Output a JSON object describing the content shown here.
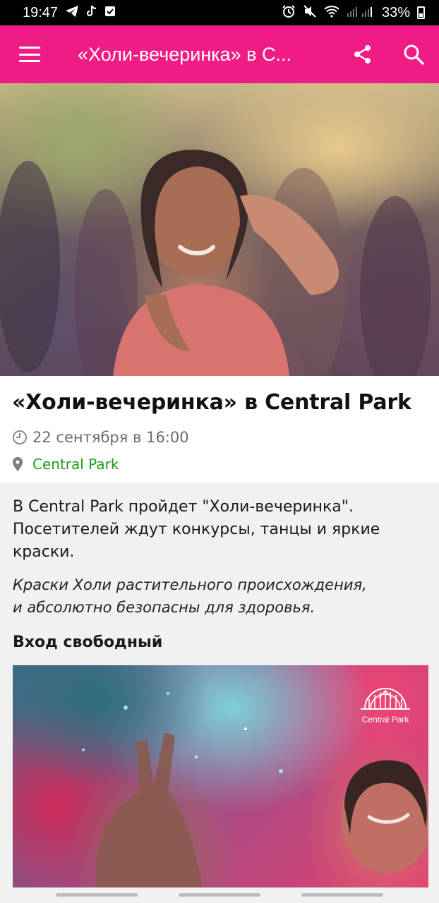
{
  "status_bar": {
    "time": "19:47",
    "battery": "33%"
  },
  "app_bar": {
    "title": "«Холи-вечеринка» в Central Park",
    "title_display": "«Холи-вечеринка» в C...",
    "icons": [
      "menu-icon",
      "share-icon",
      "search-icon"
    ],
    "background": "#ee1c84"
  },
  "event": {
    "title": "«Холи-вечеринка» в Central Park",
    "date": "22 сентября в 16:00",
    "place": "Central Park",
    "place_color": "#1b9c1b"
  },
  "description": {
    "paragraph": "В Central Park пройдет \"Холи-вечеринка\". Посетителей ждут конкурсы, танцы и яркие краски.",
    "note_line1": "Краски Холи растительного происхождения,",
    "note_line2": "и абсолютно безопасны для здоровья.",
    "entry": "Вход свободный"
  },
  "promo": {
    "logo_text": "Central Park"
  }
}
